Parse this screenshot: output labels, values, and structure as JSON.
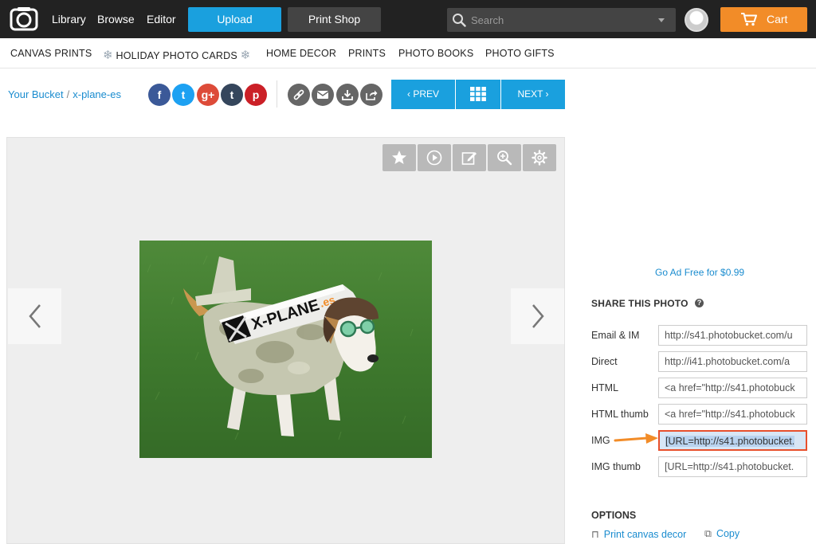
{
  "topnav": {
    "library": "Library",
    "browse": "Browse",
    "editor": "Editor",
    "upload": "Upload",
    "print_shop": "Print Shop",
    "search_placeholder": "Search",
    "cart": "Cart"
  },
  "categories": [
    "CANVAS PRINTS",
    "HOLIDAY PHOTO CARDS",
    "HOME DECOR",
    "PRINTS",
    "PHOTO BOOKS",
    "PHOTO GIFTS"
  ],
  "breadcrumb": {
    "root": "Your Bucket",
    "separator": "/",
    "album": "x-plane-es"
  },
  "social": [
    "f",
    "t",
    "g+",
    "t",
    "p"
  ],
  "pager": {
    "prev": "‹ PREV",
    "next": "NEXT ›"
  },
  "viewer": {
    "photo_logo_text": "X-PLANE",
    "photo_logo_suffix": ".es"
  },
  "sidebar": {
    "ad_free": "Go Ad Free for $0.99",
    "share_title": "SHARE THIS PHOTO",
    "help": "?",
    "rows": [
      {
        "label": "Email & IM",
        "value": "http://s41.photobucket.com/u"
      },
      {
        "label": "Direct",
        "value": "http://i41.photobucket.com/a"
      },
      {
        "label": "HTML",
        "value": "<a href=\"http://s41.photobuck"
      },
      {
        "label": "HTML thumb",
        "value": "<a href=\"http://s41.photobuck"
      },
      {
        "label": "IMG",
        "value": "[URL=http://s41.photobucket."
      },
      {
        "label": "IMG thumb",
        "value": "[URL=http://s41.photobucket."
      }
    ],
    "options_title": "OPTIONS",
    "print_canvas": "Print canvas decor",
    "copy": "Copy"
  },
  "colors": {
    "accent_blue": "#1aa0de",
    "cart_orange": "#f28c28",
    "highlight_border": "#e8502c"
  },
  "icons": [
    "camera-logo-icon",
    "search-icon",
    "chevron-down-icon",
    "cart-icon",
    "link-icon",
    "email-icon",
    "download-icon",
    "share-icon",
    "grid-icon",
    "star-icon",
    "play-icon",
    "edit-icon",
    "zoom-icon",
    "gear-icon",
    "chevron-left-icon",
    "chevron-right-icon",
    "help-icon",
    "arrow-right-icon",
    "frame-icon",
    "copy-icon"
  ]
}
